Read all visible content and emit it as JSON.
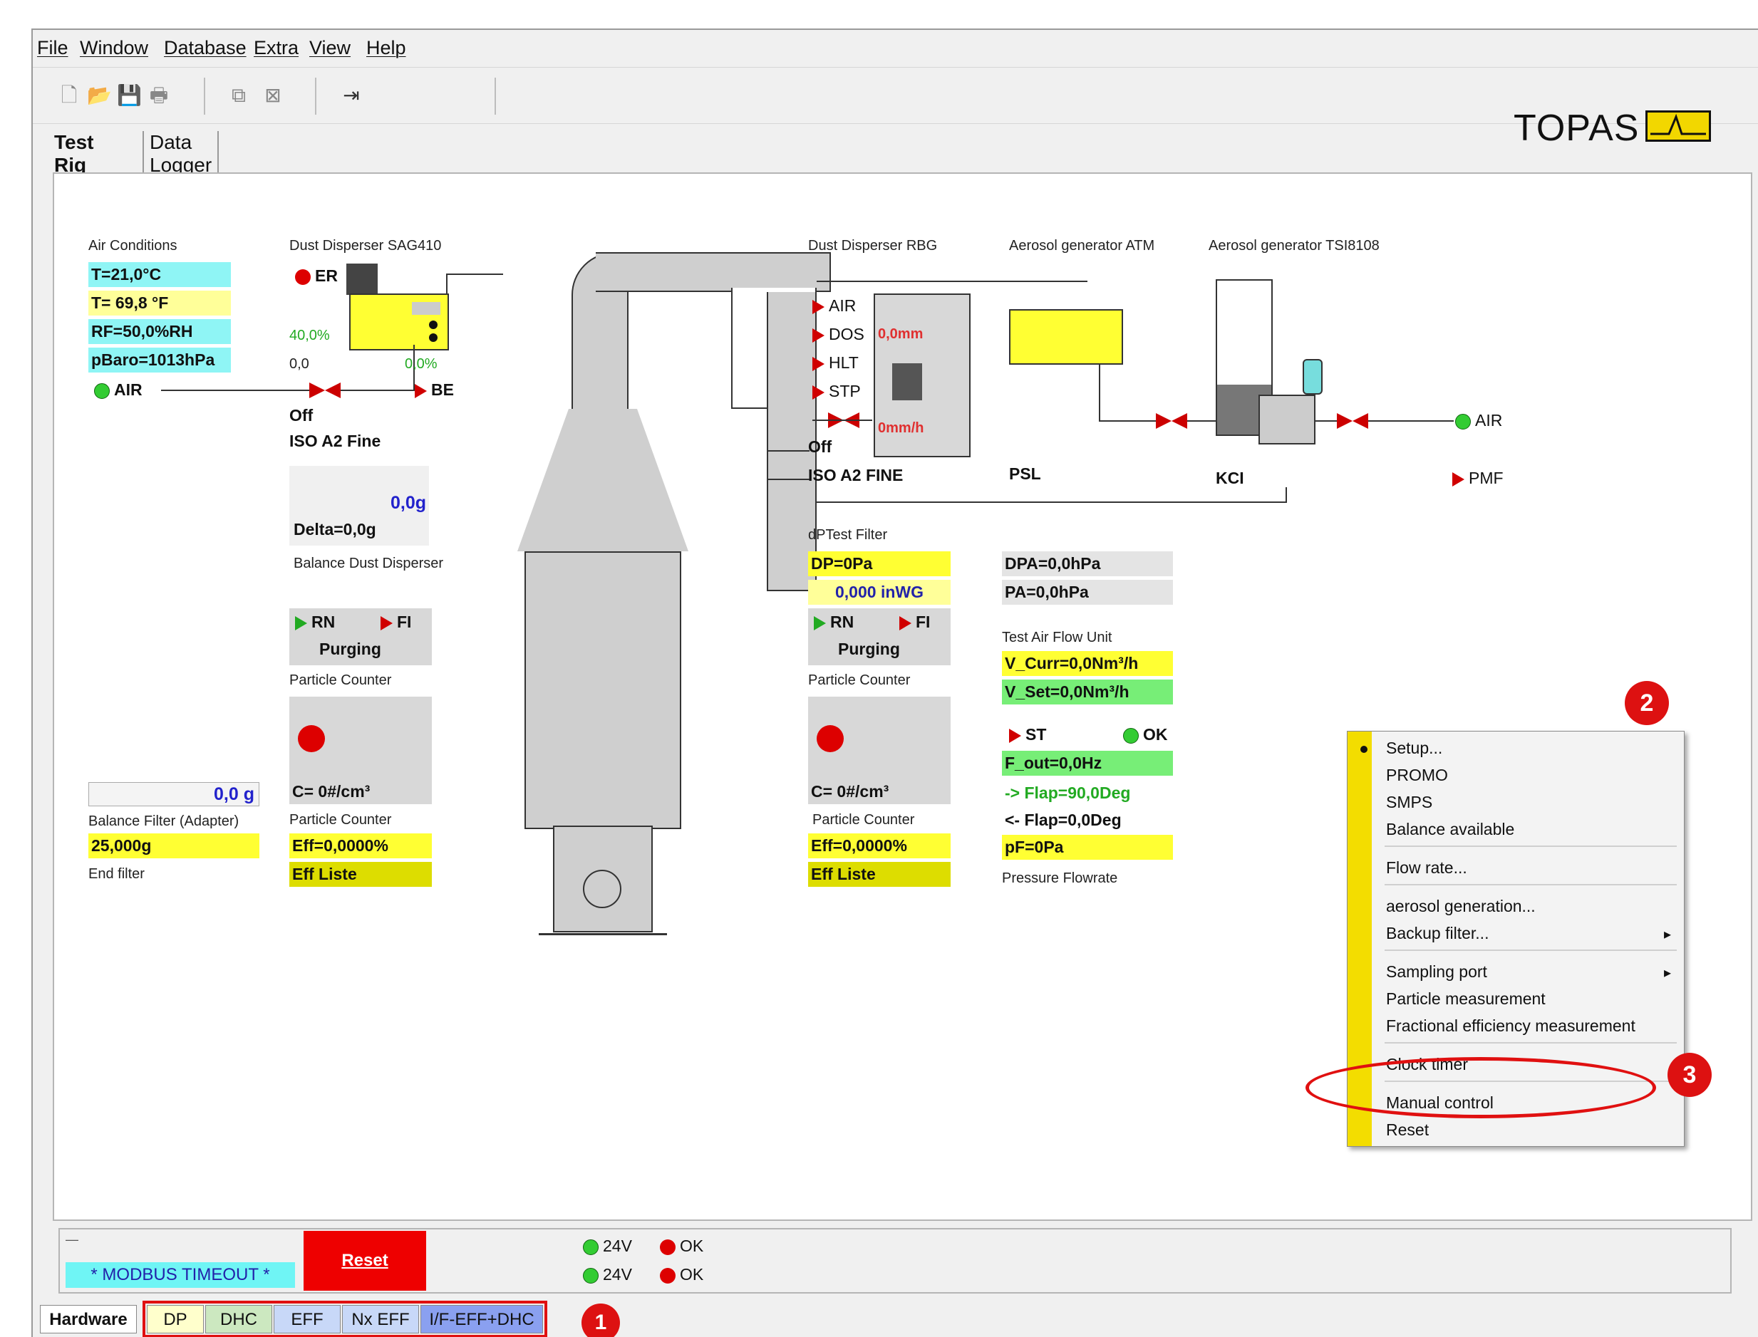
{
  "menu": [
    "File",
    "Window",
    "Database",
    "Extra",
    "View",
    "Help"
  ],
  "brand": {
    "name": "TOPAS",
    "brand_color": "#f2d700"
  },
  "tabs": [
    "Test Rig",
    "Data Logger"
  ],
  "air": {
    "title": "Air Conditions",
    "temp_c": "T=21,0°C",
    "temp_f": "T= 69,8 °F",
    "rh": "RF=50,0%RH",
    "pbaro": "pBaro=1013hPa",
    "air_label": "AIR"
  },
  "sag": {
    "title": "Dust Disperser SAG410",
    "er": "ER",
    "pct1": "40,0%",
    "v1": "0,0",
    "pct2": "0,0%",
    "be": "BE",
    "off": "Off",
    "grade": "ISO A2 Fine",
    "weight": "0,0g",
    "delta": "Delta=0,0g",
    "bal": "Balance Dust Disperser"
  },
  "pc1": {
    "rn": "RN",
    "fi": "FI",
    "purging": "Purging",
    "title": "Particle Counter",
    "conc": "C= 0#/cm³",
    "title2": "Particle Counter",
    "eff": "Eff=0,0000%",
    "effl": "Eff Liste"
  },
  "balf": {
    "val": "0,0 g",
    "title": "Balance Filter (Adapter)",
    "end_val": "25,000g",
    "end": "End filter"
  },
  "rbg": {
    "title": "Dust Disperser RBG",
    "air": "AIR",
    "dos": "DOS",
    "mm": "0,0mm",
    "hlt": "HLT",
    "stp": "STP",
    "mmh": "0mm/h",
    "off": "Off",
    "grade": "ISO A2 FINE"
  },
  "atm": {
    "title": "Aerosol generator ATM",
    "name": "PSL"
  },
  "tsi": {
    "title": "Aerosol generator  TSI8108",
    "name": "KCI",
    "air": "AIR",
    "pmf": "PMF"
  },
  "dpt": {
    "title": "dPTest Filter",
    "dp": "DP=0Pa",
    "inwg": "0,000 inWG",
    "rn": "RN",
    "fi": "FI",
    "purging": "Purging",
    "pc": "Particle Counter",
    "conc": "C= 0#/cm³",
    "pc2": "Particle Counter",
    "eff": "Eff=0,0000%",
    "effl": "Eff Liste"
  },
  "flow": {
    "dpa": "DPA=0,0hPa",
    "pa": "PA=0,0hPa",
    "title": "Test Air Flow Unit",
    "vcurr": "V_Curr=0,0Nm³/h",
    "vset": "V_Set=0,0Nm³/h",
    "st": "ST",
    "ok": "OK",
    "fout": "F_out=0,0Hz",
    "flap1": "-> Flap=90,0Deg",
    "flap2": "<- Flap=0,0Deg",
    "pf": "pF=0Pa",
    "pflow": "Pressure Flowrate"
  },
  "context_menu": [
    "Setup...",
    "PROMO",
    "SMPS",
    "Balance available",
    "Flow rate...",
    "aerosol generation...",
    "Backup filter...",
    "Sampling port",
    "Particle measurement",
    "Fractional efficiency measurement",
    "Clock timer",
    "Manual control",
    "Reset"
  ],
  "status": {
    "dash": "—",
    "modbus": "* MODBUS TIMEOUT *",
    "reset": "Reset",
    "v1": "24V",
    "ok1": "OK",
    "v2": "24V",
    "ok2": "OK"
  },
  "bottom_tabs": [
    "Hardware",
    "DP",
    "DHC",
    "EFF",
    "Nx EFF",
    "I/F-EFF+DHC"
  ],
  "badges": [
    "1",
    "2",
    "3"
  ]
}
